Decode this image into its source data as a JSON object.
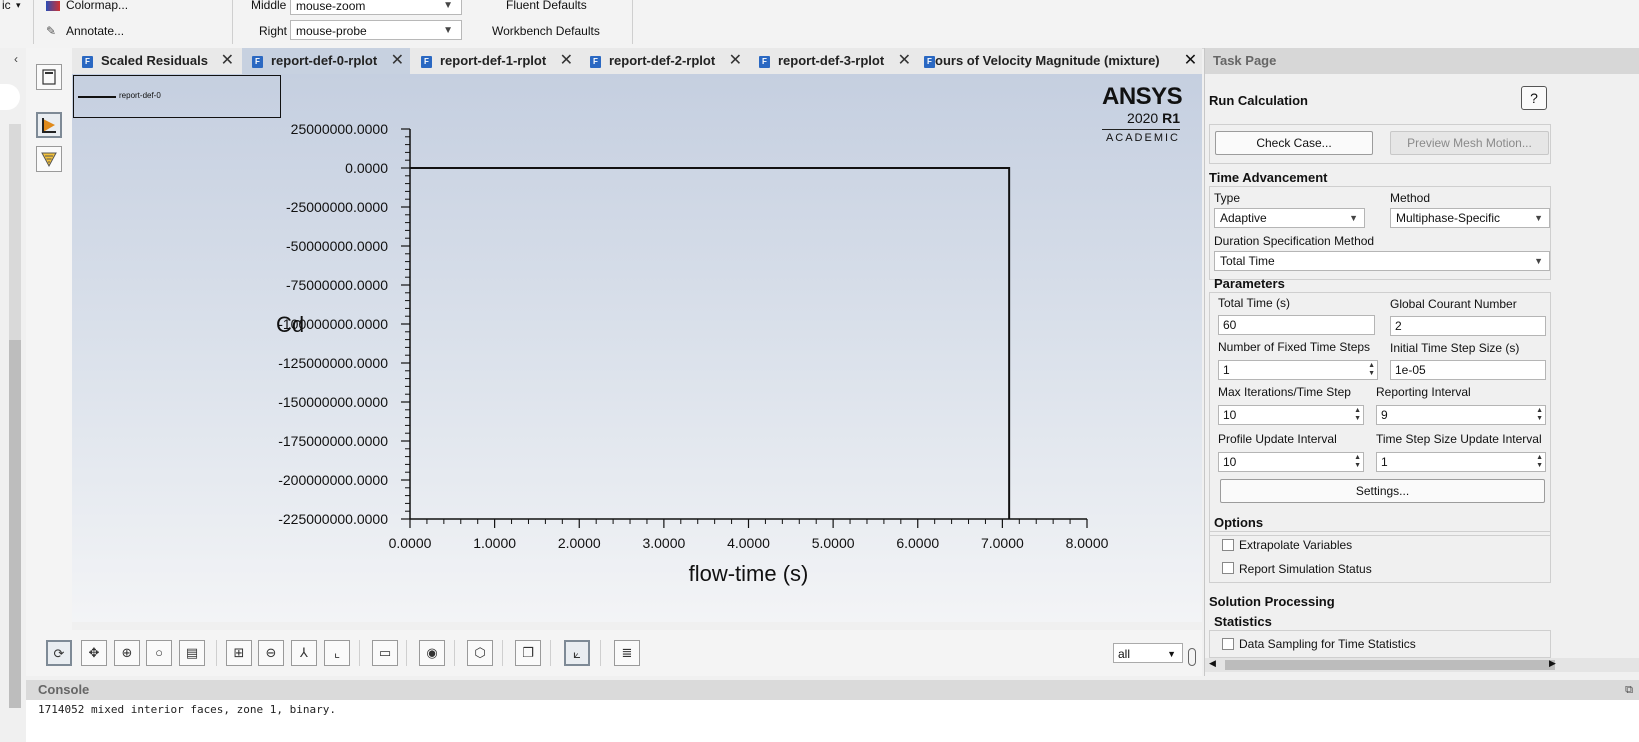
{
  "ribbon": {
    "left_cut": "ic",
    "colormap": "Colormap...",
    "annotate": "Annotate...",
    "middle_label": "Middle",
    "middle_value": "mouse-zoom",
    "right_label": "Right",
    "right_value": "mouse-probe",
    "fluent_defaults": "Fluent Defaults",
    "workbench_defaults": "Workbench Defaults"
  },
  "tabs": [
    {
      "label": "Scaled Residuals",
      "active": false
    },
    {
      "label": "report-def-0-rplot",
      "active": true
    },
    {
      "label": "report-def-1-rplot",
      "active": false
    },
    {
      "label": "report-def-2-rplot",
      "active": false
    },
    {
      "label": "report-def-3-rplot",
      "active": false
    },
    {
      "label": "ours of Velocity Magnitude (mixture)",
      "active": false
    }
  ],
  "logo": {
    "brand": "ANSYS",
    "version": "2020",
    "release": "R1",
    "edition": "ACADEMIC"
  },
  "chart_data": {
    "type": "line",
    "xlabel": "flow-time (s)",
    "ylabel": "Cd",
    "xlim": [
      0,
      8
    ],
    "ylim": [
      -225000000,
      25000000
    ],
    "x_ticks": [
      "0.0000",
      "1.0000",
      "2.0000",
      "3.0000",
      "4.0000",
      "5.0000",
      "6.0000",
      "7.0000",
      "8.0000"
    ],
    "y_ticks": [
      "25000000.0000",
      "0.0000",
      "-25000000.0000",
      "-50000000.0000",
      "-75000000.0000",
      "-100000000.0000",
      "-125000000.0000",
      "-150000000.0000",
      "-175000000.0000",
      "-200000000.0000",
      "-225000000.0000"
    ],
    "series": [
      {
        "name": "report-def-0",
        "x": [
          0,
          7.08,
          7.08
        ],
        "y": [
          0,
          0,
          -225000000
        ]
      }
    ],
    "legend": "top-left",
    "grid": false
  },
  "bottom_toolbar": {
    "scope_select": "all"
  },
  "task_page": {
    "header": "Task Page",
    "title": "Run Calculation",
    "check_case": "Check Case...",
    "preview_mesh": "Preview Mesh Motion...",
    "time_advancement": "Time Advancement",
    "type_label": "Type",
    "type_value": "Adaptive",
    "method_label": "Method",
    "method_value": "Multiphase-Specific",
    "duration_label": "Duration Specification Method",
    "duration_value": "Total Time",
    "parameters": "Parameters",
    "total_time_label": "Total Time (s)",
    "total_time_value": "60",
    "courant_label": "Global Courant Number",
    "courant_value": "2",
    "fixed_steps_label": "Number of Fixed Time Steps",
    "fixed_steps_value": "1",
    "init_step_label": "Initial Time Step Size (s)",
    "init_step_value": "1e-05",
    "max_iter_label": "Max Iterations/Time Step",
    "max_iter_value": "10",
    "report_interval_label": "Reporting Interval",
    "report_interval_value": "9",
    "profile_label": "Profile Update Interval",
    "profile_value": "10",
    "ts_update_label": "Time Step Size Update Interval",
    "ts_update_value": "1",
    "settings": "Settings...",
    "options": "Options",
    "extrapolate": "Extrapolate Variables",
    "report_status": "Report Simulation Status",
    "solution_processing": "Solution Processing",
    "statistics": "Statistics",
    "data_sampling": "Data Sampling for Time Statistics"
  },
  "console": {
    "header": "Console",
    "line": "1714052 mixed interior faces, zone  1, binary."
  }
}
